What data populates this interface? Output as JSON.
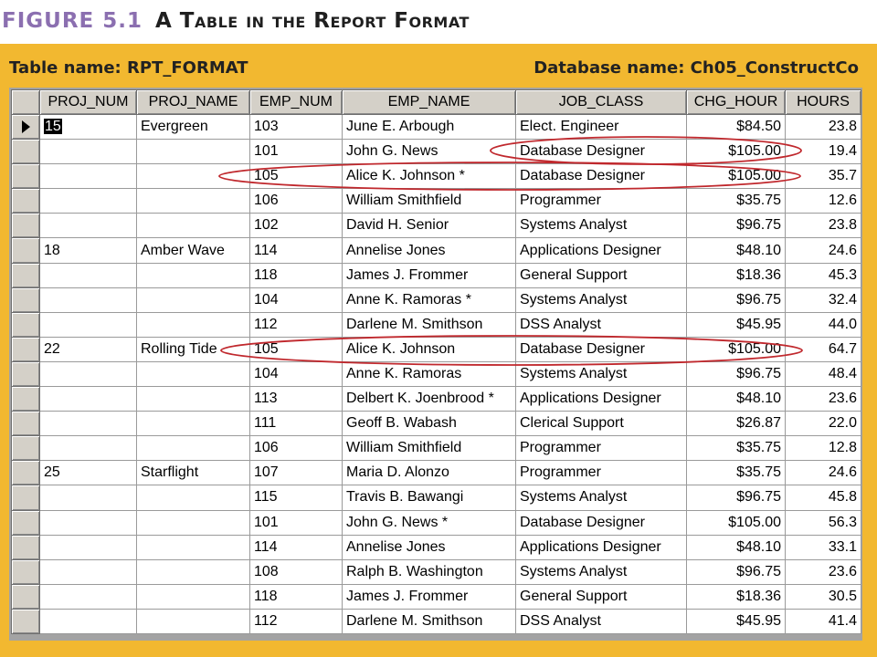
{
  "figure": {
    "number": "FIGURE 5.1",
    "caption": "A Table in the Report Format"
  },
  "panel": {
    "table_name": "Table name: RPT_FORMAT",
    "database_name": "Database name: Ch05_ConstructCo"
  },
  "columns": [
    "PROJ_NUM",
    "PROJ_NAME",
    "EMP_NUM",
    "EMP_NAME",
    "JOB_CLASS",
    "CHG_HOUR",
    "HOURS"
  ],
  "rows": [
    [
      "15",
      "Evergreen",
      "103",
      "June E. Arbough",
      "Elect. Engineer",
      "$84.50",
      "23.8"
    ],
    [
      "",
      "",
      "101",
      "John G. News",
      "Database Designer",
      "$105.00",
      "19.4"
    ],
    [
      "",
      "",
      "105",
      "Alice K. Johnson *",
      "Database Designer",
      "$105.00",
      "35.7"
    ],
    [
      "",
      "",
      "106",
      "William Smithfield",
      "Programmer",
      "$35.75",
      "12.6"
    ],
    [
      "",
      "",
      "102",
      "David H. Senior",
      "Systems Analyst",
      "$96.75",
      "23.8"
    ],
    [
      "18",
      "Amber Wave",
      "114",
      "Annelise Jones",
      "Applications Designer",
      "$48.10",
      "24.6"
    ],
    [
      "",
      "",
      "118",
      "James J. Frommer",
      "General Support",
      "$18.36",
      "45.3"
    ],
    [
      "",
      "",
      "104",
      "Anne K. Ramoras *",
      "Systems Analyst",
      "$96.75",
      "32.4"
    ],
    [
      "",
      "",
      "112",
      "Darlene M. Smithson",
      "DSS Analyst",
      "$45.95",
      "44.0"
    ],
    [
      "22",
      "Rolling Tide",
      "105",
      "Alice K. Johnson",
      "Database Designer",
      "$105.00",
      "64.7"
    ],
    [
      "",
      "",
      "104",
      "Anne K. Ramoras",
      "Systems Analyst",
      "$96.75",
      "48.4"
    ],
    [
      "",
      "",
      "113",
      "Delbert K. Joenbrood *",
      "Applications Designer",
      "$48.10",
      "23.6"
    ],
    [
      "",
      "",
      "111",
      "Geoff B. Wabash",
      "Clerical Support",
      "$26.87",
      "22.0"
    ],
    [
      "",
      "",
      "106",
      "William Smithfield",
      "Programmer",
      "$35.75",
      "12.8"
    ],
    [
      "25",
      "Starflight",
      "107",
      "Maria D. Alonzo",
      "Programmer",
      "$35.75",
      "24.6"
    ],
    [
      "",
      "",
      "115",
      "Travis B. Bawangi",
      "Systems Analyst",
      "$96.75",
      "45.8"
    ],
    [
      "",
      "",
      "101",
      "John G. News *",
      "Database Designer",
      "$105.00",
      "56.3"
    ],
    [
      "",
      "",
      "114",
      "Annelise Jones",
      "Applications Designer",
      "$48.10",
      "33.1"
    ],
    [
      "",
      "",
      "108",
      "Ralph B. Washington",
      "Systems Analyst",
      "$96.75",
      "23.6"
    ],
    [
      "",
      "",
      "118",
      "James J. Frommer",
      "General Support",
      "$18.36",
      "30.5"
    ],
    [
      "",
      "",
      "112",
      "Darlene M. Smithson",
      "DSS Analyst",
      "$45.95",
      "41.4"
    ]
  ],
  "current_record_index": 0,
  "annotation_color": "#c0282d",
  "header_accent_color": "#8b6fb0",
  "panel_color": "#f2b830"
}
